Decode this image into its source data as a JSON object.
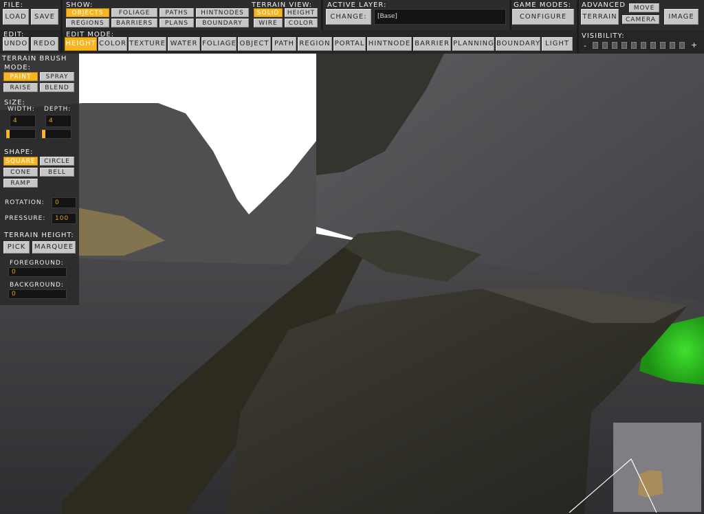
{
  "file": {
    "label": "File:",
    "load": "Load",
    "save": "Save"
  },
  "edit": {
    "label": "Edit:",
    "undo": "Undo",
    "redo": "Redo"
  },
  "show": {
    "label": "Show:",
    "items": [
      "Objects",
      "Foliage",
      "Paths",
      "HintNodes",
      "Regions",
      "Barriers",
      "Plans",
      "Boundary"
    ],
    "selected": "Objects"
  },
  "terrain_view": {
    "label": "Terrain View:",
    "items": [
      "Solid",
      "Height",
      "Wire",
      "Color"
    ],
    "selected": "Solid"
  },
  "active_layer": {
    "label": "Active Layer:",
    "change": "Change:",
    "value": "[Base]"
  },
  "game_modes": {
    "label": "Game Modes:",
    "configure": "Configure"
  },
  "advanced": {
    "label": "Advanced",
    "terrain": "Terrain",
    "move": "Move",
    "camera": "Camera",
    "image": "Image"
  },
  "edit_mode": {
    "label": "Edit Mode:",
    "items": [
      "Height",
      "Color",
      "Texture",
      "Water",
      "Foliage",
      "Object",
      "Path",
      "Region",
      "Portal",
      "HintNode",
      "Barrier",
      "Planning",
      "Boundary",
      "Light"
    ],
    "selected": "Height"
  },
  "visibility": {
    "label": "Visibility:",
    "minus": "-",
    "plus": "+"
  },
  "brush": {
    "title": "Terrain Brush",
    "mode_label": "Mode:",
    "modes": [
      "Paint",
      "Spray",
      "Raise",
      "Blend"
    ],
    "mode_selected": "Paint",
    "size_label": "Size:",
    "width_label": "Width:",
    "depth_label": "Depth:",
    "width": "4",
    "depth": "4",
    "shape_label": "Shape:",
    "shapes": [
      "Square",
      "Circle",
      "Cone",
      "Bell",
      "Ramp"
    ],
    "shape_selected": "Square",
    "rotation_label": "Rotation:",
    "rotation": "0",
    "pressure_label": "Pressure:",
    "pressure": "100",
    "terrain_height_label": "Terrain Height:",
    "pick": "Pick",
    "marquee": "Marquee",
    "foreground_label": "Foreground:",
    "foreground": "0",
    "background_label": "Background:",
    "background": "0"
  },
  "colors": {
    "accent": "#f6b522",
    "panel": "#2c2c2e",
    "button": "#c7c7c7"
  }
}
